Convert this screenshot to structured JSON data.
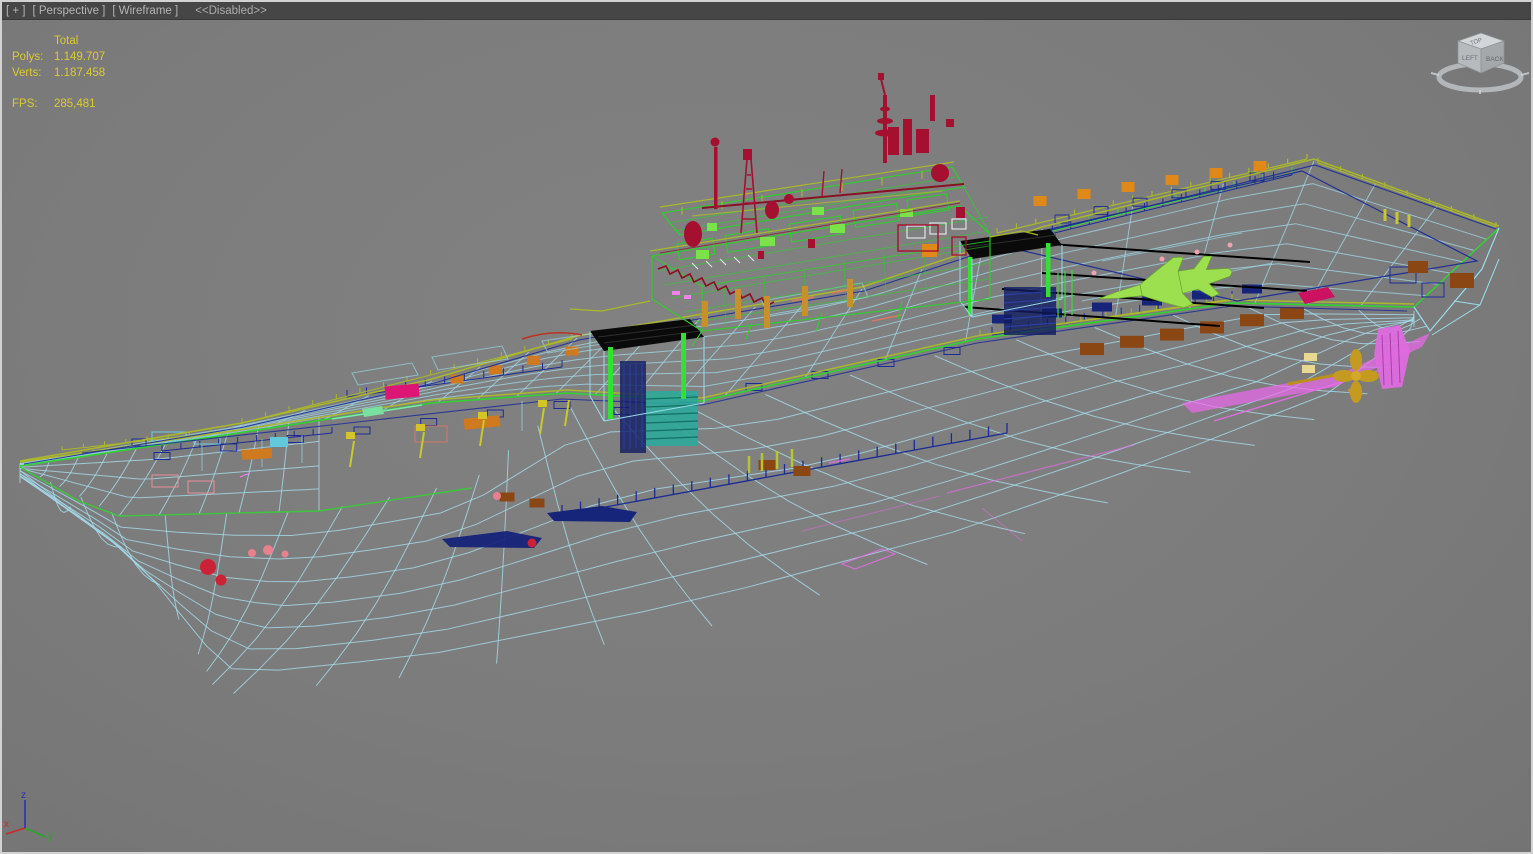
{
  "viewport": {
    "menu_bar": {
      "general": "[ + ]",
      "point_of_view": "[ Perspective ]",
      "shading": "[ Wireframe ]",
      "status": "<<Disabled>>"
    },
    "statistics": {
      "header": "Total",
      "polys_label": "Polys:",
      "polys_value": "1.149.707",
      "verts_label": "Verts:",
      "verts_value": "1.187.458",
      "fps_label": "FPS:",
      "fps_value": "285,481",
      "text_color": "#dcca32"
    },
    "axis_tripod": {
      "x_label": "x",
      "y_label": "y",
      "z_label": "z",
      "x_color": "#cc2a2a",
      "y_color": "#2aa52a",
      "z_color": "#2a2ac0"
    },
    "viewcube": {
      "top_face": "TOP",
      "left_face": "LEFT",
      "right_face": "BACK"
    },
    "background_color": "#7d7d7d",
    "menu_bar_color": "#464646"
  },
  "scene": {
    "description": "Wireframe 3D model of an aircraft carrier viewed in perspective",
    "wireframe_colors": {
      "hull": "#a6dcec",
      "deck_edge_green": "#2fd42f",
      "railing_olive": "#aab82a",
      "island_green": "#2bd12b",
      "mast_crimson": "#a51030",
      "detail_navy": "#1b2b96",
      "detail_orange": "#e08818",
      "detail_brown": "#8a4714",
      "detail_magenta": "#ee6aee",
      "aircraft_green": "#9ce050",
      "propeller_gold": "#c49a20"
    }
  }
}
